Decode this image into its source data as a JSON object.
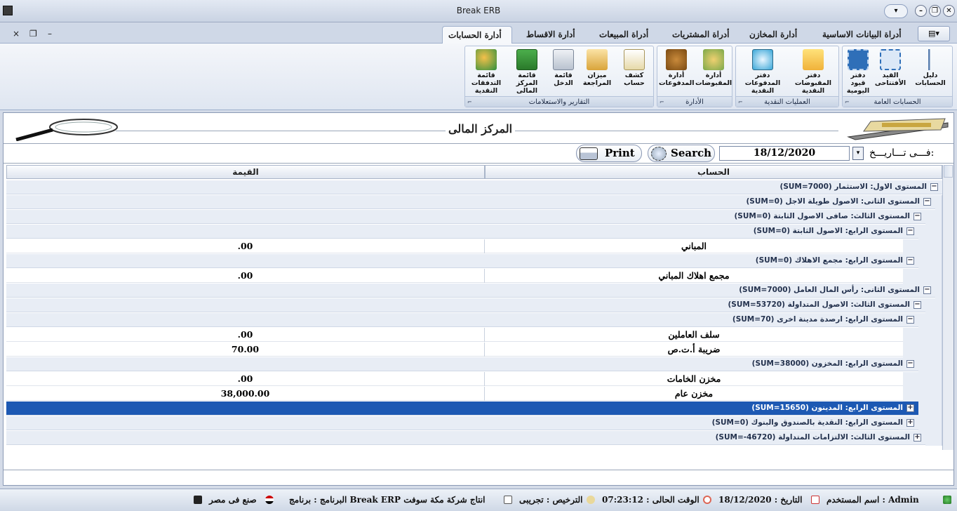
{
  "window": {
    "title": "Break ERB",
    "qa_label": "▾",
    "min": "–",
    "max": "▭",
    "restore": "❐",
    "close": "✕"
  },
  "mdi": {
    "close": "×",
    "restore": "❐",
    "min": "–"
  },
  "tabs": [
    "أدارة الحسابات",
    "أدارة الاقساط",
    "أدراة المبيعات",
    "أدراة المشتريات",
    "أدارة المخازن",
    "أدراة البيانات الاساسية"
  ],
  "app_button": "▤▾",
  "ribbon": {
    "collapse": "▲",
    "groups": [
      {
        "caption": "الحسابات العامة",
        "buttons": [
          "دليل الحسابات",
          "القيد الأفتتاحى",
          "دفتر قيود اليومية"
        ]
      },
      {
        "caption": "العمليات النقدية",
        "buttons": [
          "دفتر المقبوضات النقدية",
          "دفتر المدفوعات النقدية"
        ]
      },
      {
        "caption": "الأدارة",
        "buttons": [
          "أدارة المقبوضات",
          "أدارة المدفوعات"
        ]
      },
      {
        "caption": "التقارير والاستعلامات",
        "buttons": [
          "كشف حساب",
          "ميزان المراجعة",
          "قائمة الدخل",
          "قائمة المركز المالى",
          "قائمة التدفقات النقدية"
        ]
      }
    ],
    "expander": "⌐"
  },
  "page": {
    "title": "المركز المالى",
    "date_label": "فـــى تـــاريـــخ:",
    "date_value": "18/12/2020",
    "search_label": "Search",
    "print_label": "Print",
    "dropdown": "▾"
  },
  "grid": {
    "headers": {
      "account": "الحساب",
      "value": "القيمة"
    },
    "rows": [
      {
        "kind": "group",
        "level": 1,
        "text": "المستوى الاول: الاستثمار (SUM=7000)",
        "toggle": "−"
      },
      {
        "kind": "group",
        "level": 2,
        "text": "المستوى الثانى: الاصول طويلة الاجل (SUM=0)",
        "toggle": "−"
      },
      {
        "kind": "group",
        "level": 3,
        "text": "المستوى الثالث: صافى الاصول الثابتة (SUM=0)",
        "toggle": "−"
      },
      {
        "kind": "group",
        "level": 4,
        "text": "المستوى الرابع: الاصول الثابتة (SUM=0)",
        "toggle": "−"
      },
      {
        "kind": "leaf",
        "account": "المباني",
        "value": ".00"
      },
      {
        "kind": "group",
        "level": 4,
        "text": "المستوى الرابع: مجمع الاهلاك (SUM=0)",
        "toggle": "−"
      },
      {
        "kind": "leaf",
        "account": "مجمع اهلاك المباني",
        "value": ".00"
      },
      {
        "kind": "group",
        "level": 2,
        "text": "المستوى الثانى: رأس المال العامل (SUM=7000)",
        "toggle": "−"
      },
      {
        "kind": "group",
        "level": 3,
        "text": "المستوى الثالث: الاصول المتداولة (SUM=53720)",
        "toggle": "−"
      },
      {
        "kind": "group",
        "level": 4,
        "text": "المستوى الرابع: ارصدة مدينة اخرى (SUM=70)",
        "toggle": "−"
      },
      {
        "kind": "leaf",
        "account": "سلف العاملين",
        "value": ".00"
      },
      {
        "kind": "leaf",
        "account": "ضريبة أ.ت.ص",
        "value": "70.00"
      },
      {
        "kind": "group",
        "level": 4,
        "text": "المستوى الرابع: المخزون (SUM=38000)",
        "toggle": "−"
      },
      {
        "kind": "leaf",
        "account": "مخزن الخامات",
        "value": ".00"
      },
      {
        "kind": "leaf",
        "account": "مخزن عام",
        "value": "38,000.00"
      },
      {
        "kind": "group",
        "level": 4,
        "text": "المستوى الرابع: المدينون (SUM=15650)",
        "toggle": "+",
        "selected": true
      },
      {
        "kind": "group",
        "level": 4,
        "text": "المستوى الرابع: النقدية بالصندوق والبنوك (SUM=0)",
        "toggle": "+"
      },
      {
        "kind": "group",
        "level": 3,
        "text": "المستوى الثالث: الالتزامات المتداولة (SUM=-46720)",
        "toggle": "+"
      }
    ]
  },
  "status": {
    "user": "اسم المستخدم : Admin",
    "date": "التاريخ : 18/12/2020",
    "time": "الوقت الحالى : 07:23:12",
    "license": "الترخيص : تجريبى",
    "program": "البرنامج : برنامج Break ERP  انتاج شركة مكة سوفت",
    "made": "صنع فى مصر"
  },
  "colors": {
    "selected": "#1d59b3",
    "group_bg": "#e8edf5"
  }
}
